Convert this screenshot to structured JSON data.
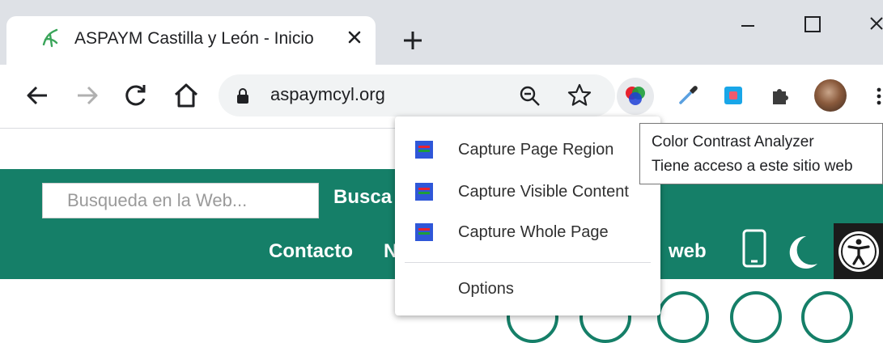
{
  "tab": {
    "title": "ASPAYM Castilla y León - Inicio"
  },
  "toolbar": {
    "url": "aspaymcyl.org"
  },
  "page": {
    "search_placeholder": "Busqueda en la Web...",
    "search_button": "Busca",
    "nav": {
      "contacto": "Contacto",
      "partial_letter": "N",
      "web": "web"
    }
  },
  "extension_menu": {
    "items": [
      {
        "label": "Capture Page Region"
      },
      {
        "label": "Capture Visible Content"
      },
      {
        "label": "Capture Whole Page"
      }
    ],
    "options_label": "Options"
  },
  "tooltip": {
    "line1": "Color Contrast Analyzer",
    "line2": "Tiene acceso a este sitio web"
  },
  "colors": {
    "brand_green": "#157f68",
    "menu_bg": "#ffffff",
    "tabstrip": "#dee1e6"
  },
  "icons": [
    "favicon-icon",
    "close-icon",
    "plus-icon",
    "minimize-icon",
    "maximize-icon",
    "window-close-icon",
    "back-icon",
    "forward-icon",
    "reload-icon",
    "home-icon",
    "lock-icon",
    "zoom-icon",
    "star-icon",
    "color-contrast-icon",
    "eyedropper-icon",
    "extension-square-icon",
    "puzzle-icon",
    "avatar",
    "kebab-menu-icon",
    "mobile-icon",
    "moon-icon",
    "accessibility-icon"
  ]
}
